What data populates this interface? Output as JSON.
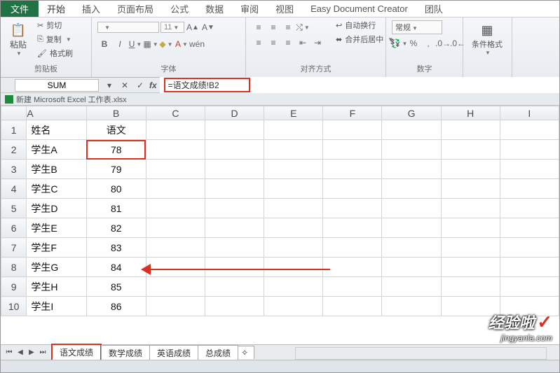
{
  "tabs": {
    "file": "文件",
    "home": "开始",
    "insert": "插入",
    "layout": "页面布局",
    "formula": "公式",
    "data": "数据",
    "review": "审阅",
    "view": "视图",
    "creator": "Easy Document Creator",
    "team": "团队"
  },
  "ribbon": {
    "clipboard": {
      "paste": "粘贴",
      "cut": "剪切",
      "copy": "复制",
      "brush": "格式刷",
      "label": "剪贴板"
    },
    "font": {
      "size": "11",
      "label": "字体"
    },
    "align": {
      "wrap": "自动换行",
      "merge": "合并后居中",
      "label": "对齐方式"
    },
    "number": {
      "format": "常规",
      "label": "数字"
    },
    "style": {
      "cond": "条件格式"
    }
  },
  "namebox": "SUM",
  "formula": "=语文成绩!B2",
  "workbook": "新建 Microsoft Excel 工作表.xlsx",
  "columns": [
    "A",
    "B",
    "C",
    "D",
    "E",
    "F",
    "G",
    "H",
    "I"
  ],
  "rows": [
    {
      "n": "1",
      "a": "姓名",
      "b": "语文"
    },
    {
      "n": "2",
      "a": "学生A",
      "b": "78"
    },
    {
      "n": "3",
      "a": "学生B",
      "b": "79"
    },
    {
      "n": "4",
      "a": "学生C",
      "b": "80"
    },
    {
      "n": "5",
      "a": "学生D",
      "b": "81"
    },
    {
      "n": "6",
      "a": "学生E",
      "b": "82"
    },
    {
      "n": "7",
      "a": "学生F",
      "b": "83"
    },
    {
      "n": "8",
      "a": "学生G",
      "b": "84"
    },
    {
      "n": "9",
      "a": "学生H",
      "b": "85"
    },
    {
      "n": "10",
      "a": "学生I",
      "b": "86"
    }
  ],
  "sheets": {
    "s1": "语文成绩",
    "s2": "数学成绩",
    "s3": "英语成绩",
    "s4": "总成绩"
  },
  "watermark": {
    "main": "经验啦",
    "sub": "jingyanla.com"
  }
}
